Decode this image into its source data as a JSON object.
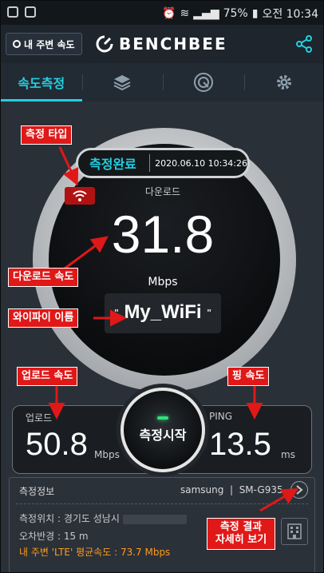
{
  "status_bar": {
    "battery": "75%",
    "clock": "오전 10:34"
  },
  "header": {
    "nearby_label": "내 주변 속도",
    "brand": "BENCHBEE"
  },
  "tabs": [
    {
      "label": "속도측정",
      "active": true
    },
    {
      "icon": "layers-icon"
    },
    {
      "icon": "history-icon"
    },
    {
      "icon": "gear-icon"
    }
  ],
  "gauge": {
    "status": "측정완료",
    "datetime": "2020.06.10 10:34:26",
    "download_label": "다운로드",
    "download_value": "31.8",
    "download_unit": "Mbps",
    "wifi_name": "My_WiFi",
    "quote_open": "\"",
    "quote_close": "\""
  },
  "speeds": {
    "upload_label": "업로드",
    "upload_value": "50.8",
    "upload_unit": "Mbps",
    "ping_label": "PING",
    "ping_value": "13.5",
    "ping_unit": "ms",
    "start_label": "측정시작"
  },
  "info": {
    "title": "측정정보",
    "device_brand": "samsung",
    "device_model": "SM-G935",
    "location": "측정위치 : 경기도 성남시",
    "error_radius": "오차반경 : 15 m",
    "avg_speed": "내 주변 'LTE' 평균속도 : 73.7 Mbps"
  },
  "annotations": {
    "type": "측정 타입",
    "download": "다운로드 속도",
    "wifi": "와이파이 이름",
    "upload": "업로드 속도",
    "ping": "핑 속도",
    "detail_1": "측정 결과",
    "detail_2": "자세히 보기"
  },
  "colors": {
    "accent": "#22d0e0",
    "annotation": "#e01818",
    "avg_speed": "#ff9b1a"
  }
}
